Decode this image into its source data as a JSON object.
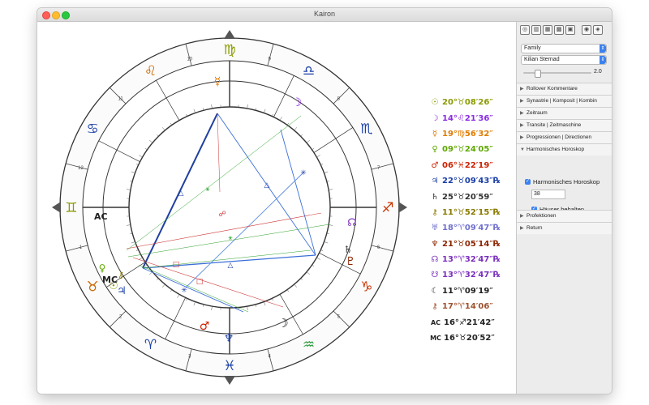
{
  "window": {
    "title": "Kairon"
  },
  "wheel": {
    "outer_signs": [
      "♍",
      "♌",
      "♋",
      "♊",
      "♉",
      "♈",
      "♓",
      "♒",
      "♑",
      "♐",
      "♏",
      "♎"
    ],
    "outer_sign_colors": [
      "#8a9a00",
      "#cc6600",
      "#1a3fa8",
      "#8a9a00",
      "#cc6600",
      "#1a3fa8",
      "#1a3fa8",
      "#2a9a3a",
      "#cc3300",
      "#cc3300",
      "#1a3fa8",
      "#1a3fa8"
    ],
    "house_numbers": [
      "1",
      "2",
      "3",
      "4",
      "5",
      "6",
      "7",
      "8",
      "9",
      "10",
      "11",
      "12"
    ],
    "ac_label": "AC",
    "mc_label": "MC"
  },
  "legend": [
    {
      "glyph": "☉",
      "color": "#8a9a00",
      "text": "20°♉08′26″"
    },
    {
      "glyph": "☽",
      "color": "#8a2be2",
      "text": "14°♌21′36″"
    },
    {
      "glyph": "☿",
      "color": "#e07b00",
      "text": "19°♍56′32″"
    },
    {
      "glyph": "♀",
      "color": "#5fa800",
      "text": "09°♉24′05″"
    },
    {
      "glyph": "♂",
      "color": "#cc2200",
      "text": "06°♓22′19″"
    },
    {
      "glyph": "♃",
      "color": "#1a3fa8",
      "text": "22°♉09′43″℞"
    },
    {
      "glyph": "♄",
      "color": "#333333",
      "text": "25°♉20′59″"
    },
    {
      "glyph": "⚷",
      "color": "#8a7a00",
      "text": "11°♉52′15″℞"
    },
    {
      "glyph": "♅",
      "color": "#7070d0",
      "text": "18°♈09′47″℞"
    },
    {
      "glyph": "♆",
      "color": "#8b2500",
      "text": "21°♉05′14″℞"
    },
    {
      "glyph": "☊",
      "color": "#7b2fbe",
      "text": "13°♈32′47″℞"
    },
    {
      "glyph": "☋",
      "color": "#7b2fbe",
      "text": "13°♈32′47″℞"
    },
    {
      "glyph": "☾",
      "color": "#222222",
      "text": "11°♈09′19″"
    },
    {
      "glyph": "⚷",
      "color": "#a0522d",
      "text": "17°♈14′06″"
    },
    {
      "glyph": "AC",
      "color": "#222222",
      "text": "16°♐21′42″"
    },
    {
      "glyph": "MC",
      "color": "#222222",
      "text": "16°♉20′52″"
    }
  ],
  "sidebar": {
    "toolbar_icons": [
      "wheel-icon",
      "bars-icon",
      "grid-icon",
      "crossgrid-icon",
      "calc-icon",
      "globe-icon",
      "layers-icon"
    ],
    "group_select": "Family",
    "person_select": "Kilian Sternad",
    "slider_value_label": "2.0",
    "slider_fraction": 0.2,
    "sections_top": [
      "Rollover Kommentare",
      "Synastrie | Komposit | Kombin",
      "Zeitraum",
      "Transite | Zeitmaschine",
      "Progressionen | Directionen",
      "Harmonisches Horoskop"
    ],
    "harmonic_checkbox": "Harmonisches Horoskop",
    "harmonic_value": "38",
    "houses_checkbox": "Häuser behalten",
    "sections_bottom": [
      "Profektionen",
      "Return"
    ]
  }
}
